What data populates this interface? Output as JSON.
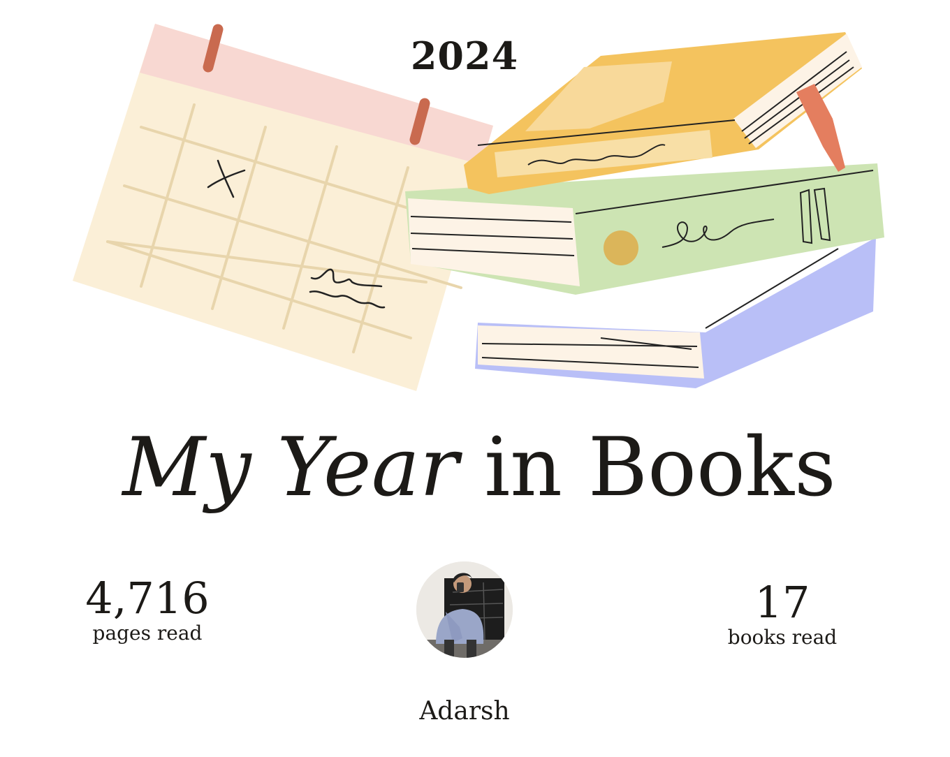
{
  "header": {
    "year": "2024"
  },
  "hero": {
    "title_part1": "My",
    "title_part2": "Year",
    "title_part3": "in Books",
    "illustration": [
      "calendar-illustration",
      "book-stack-illustration"
    ]
  },
  "stats": {
    "pages_read": {
      "value": "4,716",
      "label": "pages read"
    },
    "books_read": {
      "value": "17",
      "label": "books read"
    }
  },
  "profile": {
    "name": "Adarsh",
    "avatar_icon": "user-photo"
  },
  "colors": {
    "calendar_top": "#f8d8d2",
    "calendar_body": "#fbefd7",
    "book_yellow": "#f4c35e",
    "book_green": "#cde4b3",
    "book_blue": "#b9bff7",
    "bookmark": "#e47e5f"
  }
}
